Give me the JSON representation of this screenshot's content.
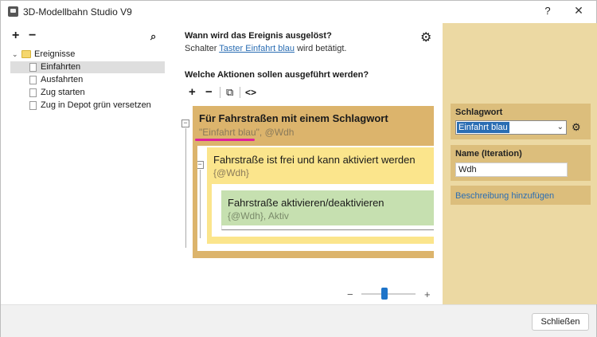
{
  "window": {
    "title": "3D-Modellbahn Studio V9",
    "help_label": "?",
    "close_label": "✕"
  },
  "tree": {
    "add_label": "+",
    "remove_label": "−",
    "search_glyph": "⌕",
    "root_chevron": "⌄",
    "root_label": "Ereignisse",
    "items": [
      {
        "label": "Einfahrten",
        "selected": true
      },
      {
        "label": "Ausfahrten",
        "selected": false
      },
      {
        "label": "Zug starten",
        "selected": false
      },
      {
        "label": "Zug in Depot grün versetzen",
        "selected": false
      }
    ]
  },
  "main": {
    "trigger_question": "Wann wird das Ereignis ausgelöst?",
    "trigger_prefix": "Schalter",
    "trigger_link": "Taster Einfahrt blau",
    "trigger_suffix": "wird betätigt.",
    "actions_question": "Welche Aktionen sollen ausgeführt werden?",
    "toolbar": {
      "add": "+",
      "remove": "−",
      "copy": "⧉",
      "code": "<>"
    },
    "collapse_glyph": "−",
    "blocks": [
      {
        "title": "Für Fahrstraßen mit einem Schlagwort",
        "sub_quoted": "\"Einfahrt blau\"",
        "sub_rest": ", @Wdh",
        "color": "#dcb46c"
      },
      {
        "title": "Fahrstraße ist frei und kann aktiviert werden",
        "sub": "{@Wdh}",
        "color": "#fbe58c"
      },
      {
        "title": "Fahrstraße aktivieren/deaktivieren",
        "sub": "{@Wdh}, Aktiv",
        "color": "#c6e0b0"
      }
    ],
    "highlight_color": "#e0219b",
    "zoom": {
      "minus": "−",
      "plus": "+",
      "level": 0.4
    }
  },
  "properties": {
    "schlagwort_label": "Schlagwort",
    "schlagwort_value": "Einfahrt blau",
    "caret": "⌄",
    "gear": "⚙",
    "name_label": "Name (Iteration)",
    "name_value": "Wdh",
    "description_link": "Beschreibung hinzufügen"
  },
  "footer": {
    "close_button": "Schließen"
  }
}
